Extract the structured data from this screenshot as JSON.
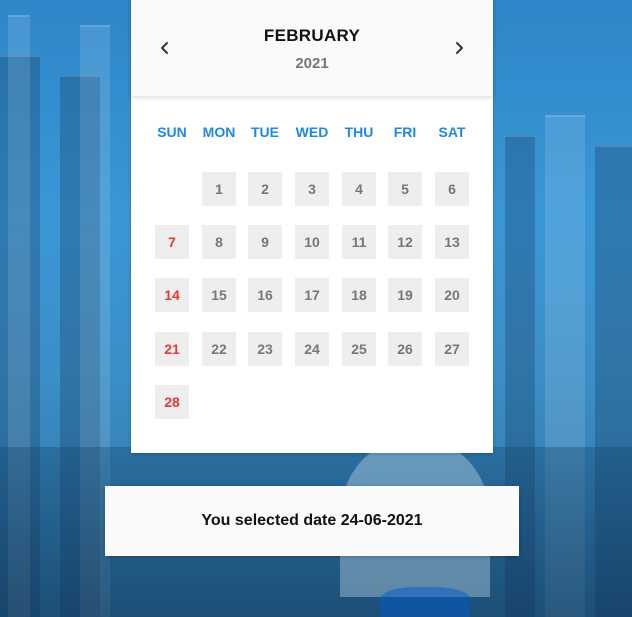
{
  "calendar": {
    "month": "FEBRUARY",
    "year": "2021",
    "weekdays": [
      "SUN",
      "MON",
      "TUE",
      "WED",
      "THU",
      "FRI",
      "SAT"
    ],
    "start_weekday_index": 1,
    "days": [
      "1",
      "2",
      "3",
      "4",
      "5",
      "6",
      "7",
      "8",
      "9",
      "10",
      "11",
      "12",
      "13",
      "14",
      "15",
      "16",
      "17",
      "18",
      "19",
      "20",
      "21",
      "22",
      "23",
      "24",
      "25",
      "26",
      "27",
      "28"
    ],
    "accent_color": "#1e88e5",
    "sunday_color": "#e53935",
    "icons": {
      "prev": "chevron-left-icon",
      "next": "chevron-right-icon"
    }
  },
  "result": {
    "text": "You selected date 24-06-2021"
  }
}
